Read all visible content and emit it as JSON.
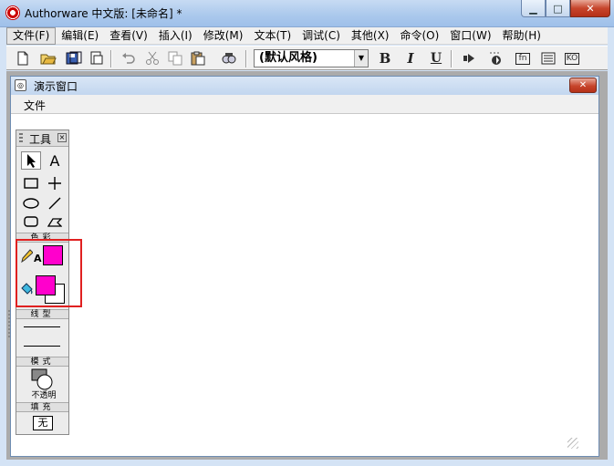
{
  "window": {
    "title": "Authorware 中文版: [未命名] *",
    "minimize": "▁",
    "maximize": "□",
    "close": "✕"
  },
  "menubar": [
    "文件(F)",
    "编辑(E)",
    "查看(V)",
    "插入(I)",
    "修改(M)",
    "文本(T)",
    "调试(C)",
    "其他(X)",
    "命令(O)",
    "窗口(W)",
    "帮助(H)"
  ],
  "toolbar": {
    "style_value": "(默认风格)",
    "bold": "B",
    "italic": "I",
    "underline": "U",
    "btn_fn": "fn",
    "btn_ko": "KO",
    "icons": [
      "new-file-icon",
      "open-folder-icon",
      "save-all-icon",
      "import-icon",
      "undo-icon",
      "cut-icon",
      "copy-icon",
      "paste-icon",
      "find-icon",
      "play-icon",
      "restart-icon",
      "functions-icon",
      "variables-icon",
      "knowledge-objects-icon"
    ]
  },
  "presentation": {
    "title": "演示窗口",
    "menu_file": "文件",
    "close": "✕"
  },
  "palette": {
    "title": "工具",
    "close": "×",
    "text_tool": "A",
    "color_label": "色彩",
    "line_label": "线型",
    "mode_label": "模式",
    "mode_value": "不透明",
    "fill_label": "填充",
    "fill_value": "无",
    "pen_text": "A",
    "colors": {
      "line_color": "#ff00cc",
      "fill_foreground": "#ff00cc",
      "fill_background": "#ffffff"
    }
  }
}
